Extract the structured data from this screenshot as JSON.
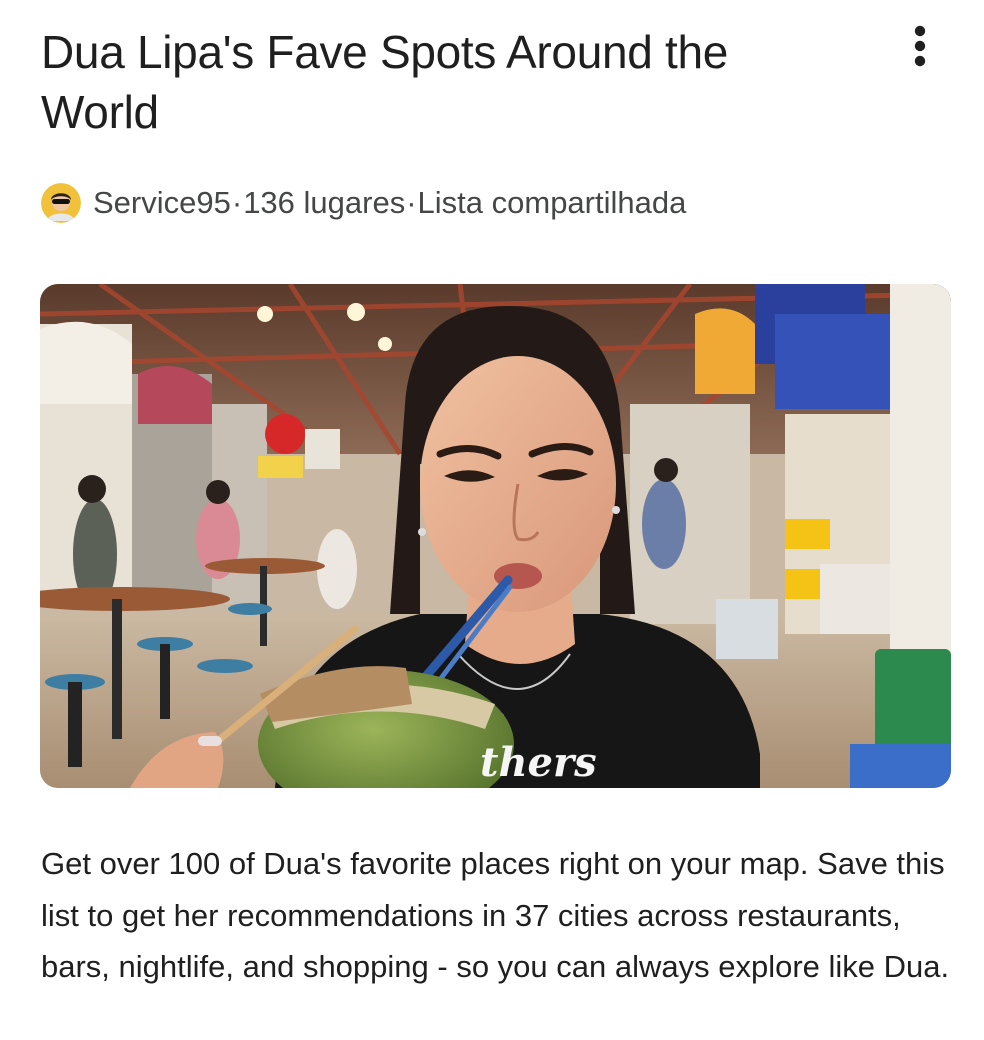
{
  "list": {
    "title": "Dua Lipa's Fave Spots Around the World",
    "author": "Service95",
    "separator": "·",
    "places_count": "136 lugares",
    "list_type": "Lista compartilhada",
    "description": "Get over 100 of Dua's favorite places right on your map. Save this list to get her recommendations in 37 cities across restaurants, bars, nightlife, and shopping - so you can always explore like Dua.",
    "hero_shirt_text": "thers"
  },
  "icons": {
    "menu": "more-vert-icon",
    "avatar": "user-avatar-icon"
  },
  "colors": {
    "text_primary": "#1f1f1f",
    "text_secondary": "#444746",
    "background": "#ffffff"
  }
}
